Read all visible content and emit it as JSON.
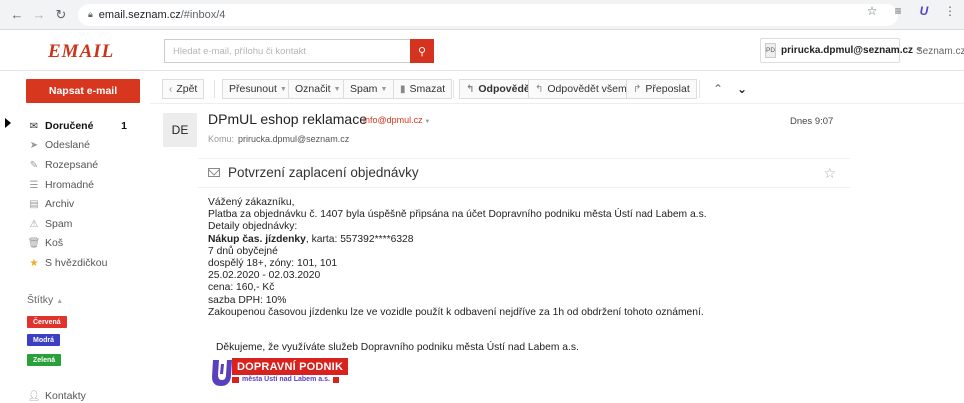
{
  "browser": {
    "url_host": "email.seznam.cz",
    "url_path": "/#inbox/4"
  },
  "header": {
    "logo": "EMAIL",
    "search_placeholder": "Hledat e-mail, přílohu či kontakt",
    "account_badge": "PD",
    "account_email": "prirucka.dpmul@seznam.cz",
    "seznam_link": "Seznam.cz"
  },
  "sidebar": {
    "compose_label": "Napsat e-mail",
    "folders": [
      {
        "label": "Doručené",
        "count": "1",
        "icon": "inbox-icon"
      },
      {
        "label": "Odeslané",
        "icon": "sent-icon"
      },
      {
        "label": "Rozepsané",
        "icon": "draft-icon"
      },
      {
        "label": "Hromadné",
        "icon": "bulk-icon"
      },
      {
        "label": "Archiv",
        "icon": "archive-icon"
      },
      {
        "label": "Spam",
        "icon": "spam-icon"
      },
      {
        "label": "Koš",
        "icon": "trash-icon"
      },
      {
        "label": "S hvězdičkou",
        "icon": "star-icon"
      }
    ],
    "labels_title": "Štítky",
    "tags": [
      "Červená",
      "Modrá",
      "Zelená"
    ],
    "contacts": "Kontakty",
    "colors": {
      "compose": "#d8371f",
      "red": "#e0332b",
      "blue": "#3b3fc4",
      "green": "#2aa03b"
    }
  },
  "toolbar": {
    "back": "Zpět",
    "move": "Přesunout",
    "mark": "Označit",
    "spam": "Spam",
    "delete": "Smazat",
    "reply": "Odpovědět",
    "reply_all": "Odpovědět všem",
    "forward": "Přeposlat"
  },
  "message": {
    "avatar": "DE",
    "sender_name": "DPmUL eshop reklamace",
    "sender_email": "info@dpmul.cz",
    "to_label": "Komu:",
    "to_value": "prirucka.dpmul@seznam.cz",
    "date": "Dnes 9:07",
    "subject": "Potvrzení zaplacení objednávky",
    "body": {
      "l1": "Vážený zákazníku,",
      "l2": "Platba za objednávku č. 1407 byla úspěšně připsána na účet Dopravního podniku města Ústí nad Labem a.s.",
      "l3": "Detaily objednávky:",
      "l4_bold": "Nákup čas. jízdenky",
      "l4_rest": ", karta: 557392****6328",
      "l5": "7 dnů obyčejné",
      "l6": "dospělý 18+, zóny: 101, 101",
      "l7": "25.02.2020 - 02.03.2020",
      "l8": "cena: 160,- Kč",
      "l9": "sazba DPH: 10%",
      "l10": "Zakoupenou časovou jízdenku lze ve vozidle použít k odbavení nejdříve za 1h od obdržení tohoto oznámení."
    },
    "thanks": "Děkujeme, že využíváte služeb Dopravního podniku města Ústí nad Labem a.s.",
    "logo_title": "DOPRAVNÍ PODNIK",
    "logo_sub": "města Ústí nad Labem a.s."
  }
}
